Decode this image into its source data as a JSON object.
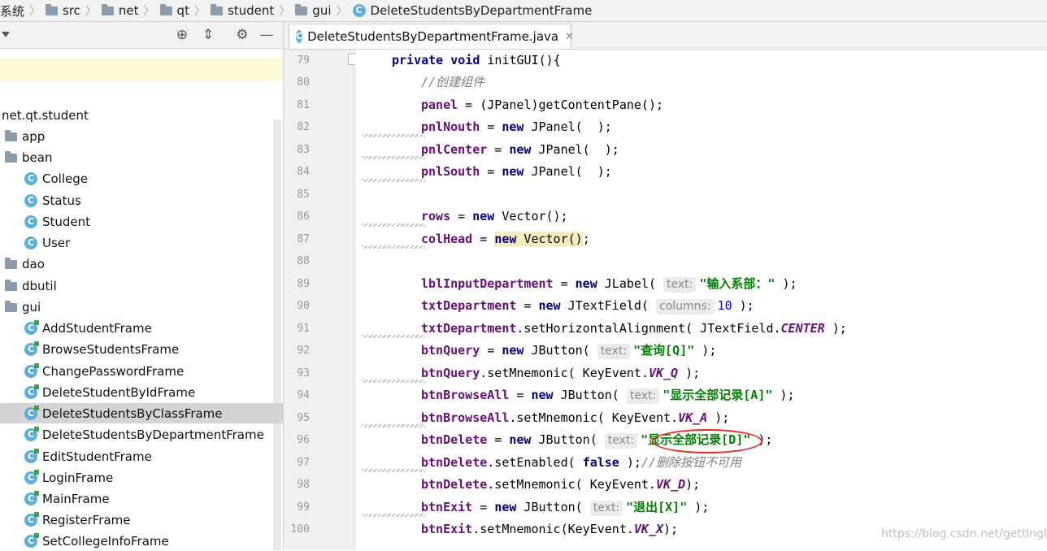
{
  "breadcrumb": [
    "系统",
    "src",
    "net",
    "qt",
    "student",
    "gui",
    "DeleteStudentsByDepartmentFrame"
  ],
  "tree": {
    "root": "net.qt.student",
    "nodes": [
      {
        "label": "app",
        "type": "package"
      },
      {
        "label": "bean",
        "type": "package"
      },
      {
        "label": "College",
        "type": "class"
      },
      {
        "label": "Status",
        "type": "class"
      },
      {
        "label": "Student",
        "type": "class"
      },
      {
        "label": "User",
        "type": "class"
      },
      {
        "label": "dao",
        "type": "package"
      },
      {
        "label": "dbutil",
        "type": "package"
      },
      {
        "label": "gui",
        "type": "package"
      },
      {
        "label": "AddStudentFrame",
        "type": "gui-class"
      },
      {
        "label": "BrowseStudentsFrame",
        "type": "gui-class"
      },
      {
        "label": "ChangePasswordFrame",
        "type": "gui-class"
      },
      {
        "label": "DeleteStudentByIdFrame",
        "type": "gui-class"
      },
      {
        "label": "DeleteStudentsByClassFrame",
        "type": "gui-class",
        "selected": true
      },
      {
        "label": "DeleteStudentsByDepartmentFrame",
        "type": "gui-class"
      },
      {
        "label": "EditStudentFrame",
        "type": "gui-class"
      },
      {
        "label": "LoginFrame",
        "type": "gui-class"
      },
      {
        "label": "MainFrame",
        "type": "gui-class"
      },
      {
        "label": "RegisterFrame",
        "type": "gui-class"
      },
      {
        "label": "SetCollegeInfoFrame",
        "type": "gui-class"
      }
    ]
  },
  "editor": {
    "tab_title": "DeleteStudentsByDepartmentFrame.java",
    "line_numbers": [
      "79",
      "80",
      "81",
      "82",
      "83",
      "84",
      "85",
      "86",
      "87",
      "88",
      "89",
      "90",
      "91",
      "92",
      "93",
      "94",
      "95",
      "96",
      "97",
      "98",
      "99",
      "100"
    ],
    "lines": {
      "l79": {
        "kw1": "private",
        "kw2": "void",
        "rest": " initGUI(){"
      },
      "l80": {
        "comment": "//创建组件"
      },
      "l81": {
        "field": "panel",
        "rest": " = (JPanel)getContentPane();"
      },
      "l82": {
        "field": "pnlNouth",
        "op": " = ",
        "kw": "new",
        "rest": " JPanel(  );"
      },
      "l83": {
        "field": "pnlCenter",
        "op": " = ",
        "kw": "new",
        "rest": " JPanel(  );"
      },
      "l84": {
        "field": "pnlSouth",
        "op": " = ",
        "kw": "new",
        "rest": " JPanel(  );"
      },
      "l86": {
        "field": "rows",
        "op": " = ",
        "kw": "new",
        "rest": " Vector();"
      },
      "l87": {
        "field": "colHead",
        "op": " = ",
        "kw": "new",
        "rest": " Vector()",
        "end": ";"
      },
      "l89": {
        "field": "lblInputDepartment",
        "op": " = ",
        "kw": "new",
        "rest": " JLabel( ",
        "hint": "text:",
        "str": "\"输入系部：\"",
        "end": " );"
      },
      "l90": {
        "field": "txtDepartment",
        "op": " = ",
        "kw": "new",
        "rest": " JTextField( ",
        "hint": "columns:",
        "num": "10",
        "end": " );"
      },
      "l91": {
        "field": "txtDepartment",
        "rest": ".setHorizontalAlignment( JTextField.",
        "const": "CENTER",
        "end": " );"
      },
      "l92": {
        "field": "btnQuery",
        "op": " = ",
        "kw": "new",
        "rest": " JButton( ",
        "hint": "text:",
        "str": "\"查询[Q]\"",
        "end": " );"
      },
      "l93": {
        "field": "btnQuery",
        "rest": ".setMnemonic( KeyEvent.",
        "const": "VK_Q",
        "end": " );"
      },
      "l94": {
        "field": "btnBrowseAll",
        "op": " = ",
        "kw": "new",
        "rest": " JButton( ",
        "hint": "text:",
        "str": "\"显示全部记录[A]\"",
        "end": " );"
      },
      "l95": {
        "field": "btnBrowseAll",
        "rest": ".setMnemonic( KeyEvent.",
        "const": "VK_A",
        "end": " );"
      },
      "l96": {
        "field": "btnDelete",
        "op": " = ",
        "kw": "new",
        "rest": " JButton( ",
        "hint": "text:",
        "str": "\"显示全部记录[D]\"",
        "end": " );"
      },
      "l97": {
        "field": "btnDelete",
        "rest": ".setEnabled( ",
        "kw": "false",
        "end": " );",
        "comment": "//删除按钮不可用"
      },
      "l98": {
        "field": "btnDelete",
        "rest": ".setMnemonic( KeyEvent.",
        "const": "VK_D",
        "end": ");"
      },
      "l99": {
        "field": "btnExit",
        "op": " = ",
        "kw": "new",
        "rest": " JButton( ",
        "hint": "text:",
        "str": "\"退出[X]\"",
        "end": " );"
      },
      "l100": {
        "field": "btnExit",
        "rest": ".setMnemonic(KeyEvent.",
        "const": "VK_X",
        "end": ");"
      }
    }
  },
  "watermark": "https://blog.csdn.net/gettingl",
  "colors": {
    "keyword": "#000080",
    "field": "#660e7a",
    "string": "#008000",
    "selection": "#d4d4d4",
    "annotation": "#e0302a"
  }
}
